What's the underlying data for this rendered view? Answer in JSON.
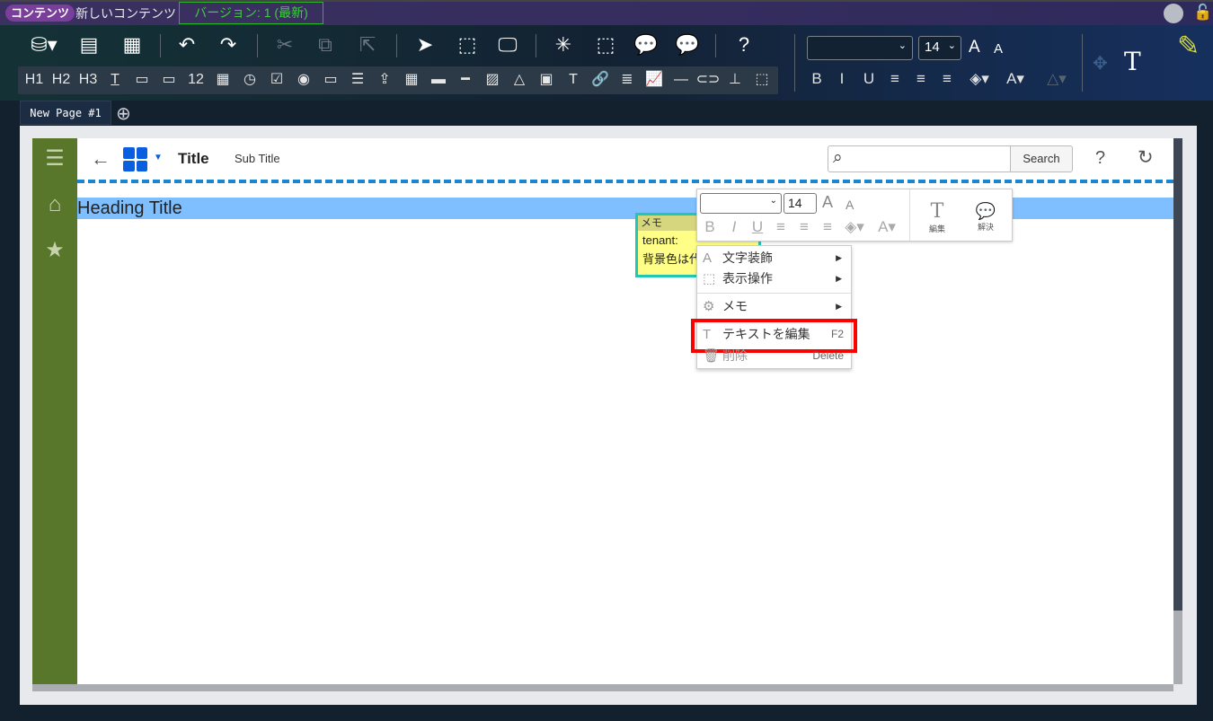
{
  "topbar": {
    "app_badge": "コンテンツ",
    "doc_title": "新しいコンテンツ",
    "version": "バージョン: 1 (最新)"
  },
  "toolbar": {
    "row1": [
      {
        "name": "data-source-icon",
        "glyph": "⛁▾"
      },
      {
        "name": "html-code-icon",
        "glyph": "▤"
      },
      {
        "name": "export-sheet-icon",
        "glyph": "▦"
      },
      {
        "name": "undo-icon",
        "glyph": "↶"
      },
      {
        "name": "redo-icon",
        "glyph": "↷"
      },
      {
        "name": "cut-icon",
        "glyph": "✂",
        "disabled": true
      },
      {
        "name": "group-icon",
        "glyph": "⧉",
        "disabled": true
      },
      {
        "name": "ungroup-icon",
        "glyph": "⇱",
        "disabled": true
      },
      {
        "name": "select-pointer-icon",
        "glyph": "➤"
      },
      {
        "name": "select-area-icon",
        "glyph": "⬚"
      },
      {
        "name": "preview-monitor-icon",
        "glyph": "🖵"
      },
      {
        "name": "loading-icon",
        "glyph": "✳"
      },
      {
        "name": "area-settings-icon",
        "glyph": "⬚"
      },
      {
        "name": "comment-edit-icon",
        "glyph": "💬"
      },
      {
        "name": "comment-settings-icon",
        "glyph": "💬"
      },
      {
        "name": "help-icon",
        "glyph": "?"
      }
    ],
    "row2": [
      {
        "name": "h1-icon",
        "glyph": "H1"
      },
      {
        "name": "h2-icon",
        "glyph": "H2"
      },
      {
        "name": "h3-icon",
        "glyph": "H3"
      },
      {
        "name": "text-input-icon",
        "glyph": "T̲"
      },
      {
        "name": "separator-input-icon",
        "glyph": "▭"
      },
      {
        "name": "textarea-icon",
        "glyph": "▭"
      },
      {
        "name": "number-input-icon",
        "glyph": "12"
      },
      {
        "name": "date-input-icon",
        "glyph": "▦"
      },
      {
        "name": "time-input-icon",
        "glyph": "◷"
      },
      {
        "name": "checkbox-icon",
        "glyph": "☑"
      },
      {
        "name": "radio-icon",
        "glyph": "◉"
      },
      {
        "name": "select-box-icon",
        "glyph": "▭"
      },
      {
        "name": "listbox-icon",
        "glyph": "☰"
      },
      {
        "name": "file-upload-icon",
        "glyph": "⇪"
      },
      {
        "name": "table-icon",
        "glyph": "▦"
      },
      {
        "name": "button-icon",
        "glyph": "▬"
      },
      {
        "name": "slider-icon",
        "glyph": "━"
      },
      {
        "name": "image-icon",
        "glyph": "▨"
      },
      {
        "name": "shapes-icon",
        "glyph": "△"
      },
      {
        "name": "frame-icon",
        "glyph": "▣"
      },
      {
        "name": "text-icon",
        "glyph": "T"
      },
      {
        "name": "link-icon",
        "glyph": "🔗"
      },
      {
        "name": "list-icon",
        "glyph": "≣"
      },
      {
        "name": "chart-icon",
        "glyph": "📈"
      },
      {
        "name": "line-icon",
        "glyph": "—"
      },
      {
        "name": "toggle-icon",
        "glyph": "⊂⊃"
      },
      {
        "name": "tree-icon",
        "glyph": "⊥"
      },
      {
        "name": "placeholder-icon",
        "glyph": "⬚"
      }
    ],
    "font_size": "14",
    "font_name": "",
    "format": [
      {
        "name": "bold-icon",
        "glyph": "B"
      },
      {
        "name": "italic-icon",
        "glyph": "I"
      },
      {
        "name": "underline-icon",
        "glyph": "U"
      },
      {
        "name": "align-left-icon",
        "glyph": "≡"
      },
      {
        "name": "align-center-icon",
        "glyph": "≡"
      },
      {
        "name": "align-right-icon",
        "glyph": "≡"
      },
      {
        "name": "fill-color-icon",
        "glyph": "◈▾"
      },
      {
        "name": "font-color-icon",
        "glyph": "A▾"
      },
      {
        "name": "shape-style-icon",
        "glyph": "△▾"
      }
    ],
    "grow_font": "A",
    "shrink_font": "A",
    "text_tool": "T"
  },
  "tabs": [
    {
      "label": "New Page #1"
    }
  ],
  "page": {
    "title": "Title",
    "subtitle": "Sub Title",
    "search_placeholder": "",
    "search_button": "Search",
    "heading": "Heading Title"
  },
  "memo": {
    "header": "メモ",
    "lines": [
      "tenant:",
      "背景色は代"
    ]
  },
  "mini_toolbar": {
    "font_size": "14",
    "edit_label": "編集",
    "resolve_label": "解決"
  },
  "context_menu": {
    "items": [
      {
        "label": "文字装飾",
        "icon": "A",
        "submenu": true
      },
      {
        "label": "表示操作",
        "icon": "⬚",
        "submenu": true
      },
      {
        "label": "メモ",
        "icon": "⚙",
        "submenu": true
      },
      {
        "label": "テキストを編集",
        "icon": "T",
        "shortcut": "F2"
      },
      {
        "label": "削除",
        "icon": "🗑",
        "shortcut": "Delete"
      }
    ]
  },
  "colors": {
    "sidebar": "#59772a",
    "heading_band": "#80bfff",
    "highlight": "#ff0000",
    "memo_border": "#20c8b4"
  }
}
